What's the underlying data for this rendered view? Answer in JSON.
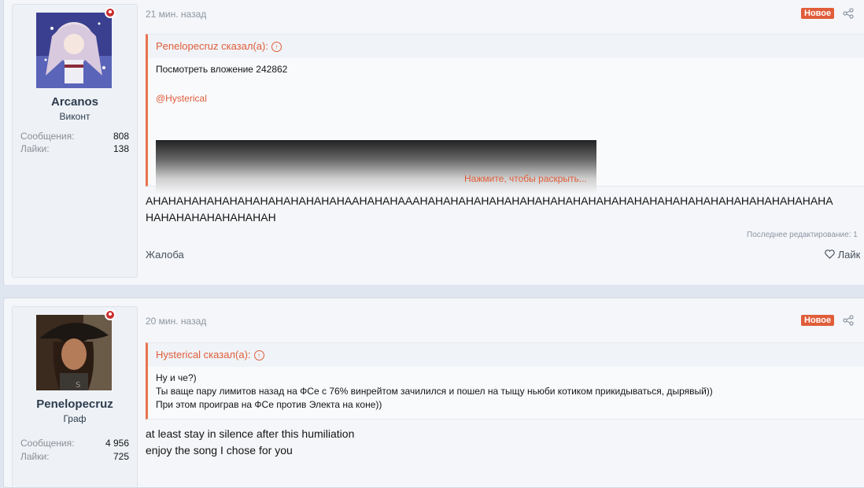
{
  "posts": [
    {
      "user": {
        "name": "Arcanos",
        "title": "Виконт",
        "stats": [
          {
            "label": "Сообщения:",
            "value": "808"
          },
          {
            "label": "Лайки:",
            "value": "138"
          }
        ],
        "avatar": "anime-girl-avatar",
        "online": true
      },
      "time": "21 мин. назад",
      "badge": "Новое",
      "quote": {
        "author": "Penelopecruz сказал(а):",
        "line1": "Посмотреть вложение 242862",
        "mention": "@Hysterical",
        "expand": "Нажмите, чтобы раскрыть..."
      },
      "body_lines": [
        "АНАНАНАНАНАНАНАНАНАНАНАНАНААНАНАНАААНАНАНАНАНАНАНАНАНАНАНАНАНАНАНАНАНАНАНАНАНАНАНАНАНАНАНА",
        "НАНАНАНАНАНАНАНАН"
      ],
      "edit_note": "Последнее редактирование: 1",
      "report": "Жалоба",
      "like": "Лайк"
    },
    {
      "user": {
        "name": "Penelopecruz",
        "title": "Граф",
        "stats": [
          {
            "label": "Сообщения:",
            "value": "4 956"
          },
          {
            "label": "Лайки:",
            "value": "725"
          }
        ],
        "avatar": "woman-pirate-hat-avatar",
        "online": true
      },
      "time": "20 мин. назад",
      "badge": "Новое",
      "quote": {
        "author": "Hysterical сказал(а):",
        "lines": [
          "Ну и че?)",
          "Ты ваще пару лимитов назад на ФСе с 76% винрейтом зачилился и пошел на тыщу ньюби котиком прикидываться, дырявый))",
          "При этом проиграв на ФСе против Электа на коне))"
        ]
      },
      "body_lines": [
        "at least stay in silence after this humiliation",
        "enjoy the song I chose for you"
      ]
    }
  ],
  "colors": {
    "accent": "#e05d3a",
    "online": "#cc2c2c",
    "background": "#dfe6ef"
  }
}
